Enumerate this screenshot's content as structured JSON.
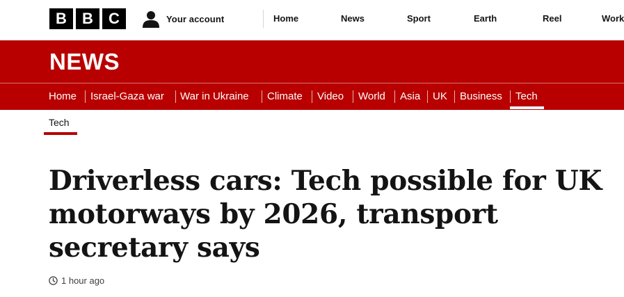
{
  "brand": {
    "logo_letters": [
      "B",
      "B",
      "C"
    ]
  },
  "account": {
    "label": "Your account",
    "icon": "person-icon"
  },
  "top_nav": [
    {
      "label": "Home"
    },
    {
      "label": "News"
    },
    {
      "label": "Sport"
    },
    {
      "label": "Earth"
    },
    {
      "label": "Reel"
    },
    {
      "label": "Work"
    }
  ],
  "banner": {
    "wordmark": "NEWS",
    "color": "#b80000"
  },
  "section_nav": {
    "items": [
      {
        "label": "Home"
      },
      {
        "label": "Israel-Gaza war"
      },
      {
        "label": "War in Ukraine"
      },
      {
        "label": "Climate"
      },
      {
        "label": "Video"
      },
      {
        "label": "World"
      },
      {
        "label": "Asia"
      },
      {
        "label": "UK"
      },
      {
        "label": "Business"
      },
      {
        "label": "Tech"
      }
    ],
    "active": "Tech"
  },
  "sub_nav": {
    "label": "Tech",
    "active": true
  },
  "article": {
    "headline": "Driverless cars: Tech possible for UK motorways by 2026, transport secretary says",
    "timestamp": "1 hour ago",
    "timestamp_icon": "clock-icon"
  }
}
